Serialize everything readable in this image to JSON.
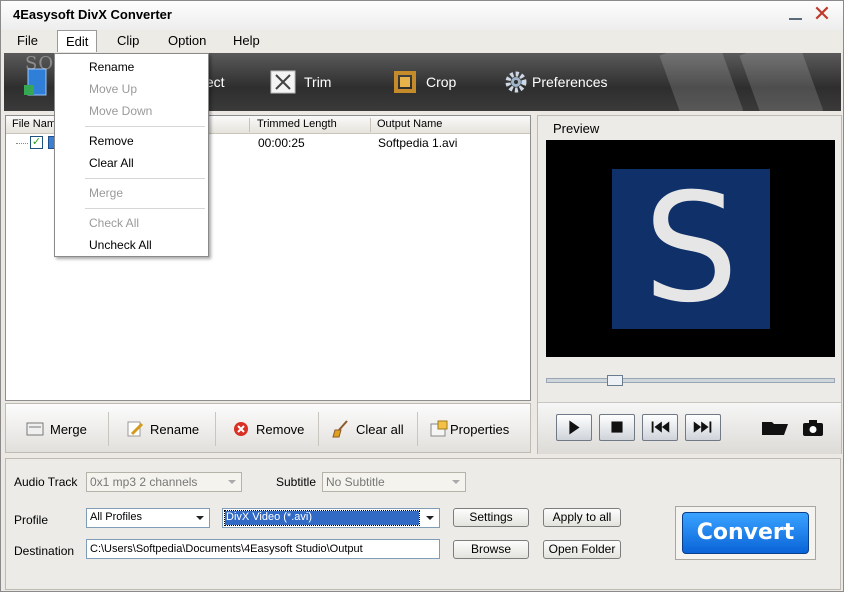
{
  "window": {
    "title": "4Easysoft DivX Converter",
    "close_symbol": "✕"
  },
  "menu": {
    "items": [
      {
        "label": "File"
      },
      {
        "label": "Edit"
      },
      {
        "label": "Clip"
      },
      {
        "label": "Option"
      },
      {
        "label": "Help"
      }
    ],
    "active": "Edit"
  },
  "toolbar": {
    "effect_label": "fect",
    "trim_label": "Trim",
    "crop_label": "Crop",
    "preferences_label": "Preferences",
    "watermark": "SOFTPEDIA"
  },
  "edit_menu": {
    "items": [
      {
        "label": "Rename",
        "enabled": true
      },
      {
        "label": "Move Up",
        "enabled": false
      },
      {
        "label": "Move Down",
        "enabled": false
      },
      {
        "label": "Remove",
        "enabled": true
      },
      {
        "label": "Clear All",
        "enabled": true
      },
      {
        "label": "Merge",
        "enabled": false
      },
      {
        "label": "Check All",
        "enabled": false
      },
      {
        "label": "Uncheck All",
        "enabled": true
      }
    ]
  },
  "file_list": {
    "columns": [
      "File Name",
      "Trimmed Length",
      "Output Name"
    ],
    "rows": [
      {
        "checked": true,
        "trimmed_length": "00:00:25",
        "output_name": "Softpedia 1.avi"
      }
    ]
  },
  "list_toolbar": {
    "merge_label": "Merge",
    "rename_label": "Rename",
    "remove_label": "Remove",
    "clear_all_label": "Clear all",
    "properties_label": "Properties"
  },
  "preview": {
    "title": "Preview",
    "image_letter": "S",
    "seek_progress": 0.22
  },
  "settings": {
    "audio_track_label": "Audio Track",
    "audio_track_value": "0x1 mp3 2 channels",
    "subtitle_label": "Subtitle",
    "subtitle_value": "No Subtitle",
    "profile_label": "Profile",
    "profile_category": "All Profiles",
    "profile_value": "DivX Video (*.avi)",
    "settings_button": "Settings",
    "apply_to_all_button": "Apply to all",
    "destination_label": "Destination",
    "destination_value": "C:\\Users\\Softpedia\\Documents\\4Easysoft Studio\\Output",
    "browse_button": "Browse",
    "open_folder_button": "Open Folder",
    "convert_button": "Convert"
  },
  "colors": {
    "accent_blue": "#0a64d8",
    "preview_bg": "#10306a",
    "toolbar_dark": "#2e2e2e"
  }
}
